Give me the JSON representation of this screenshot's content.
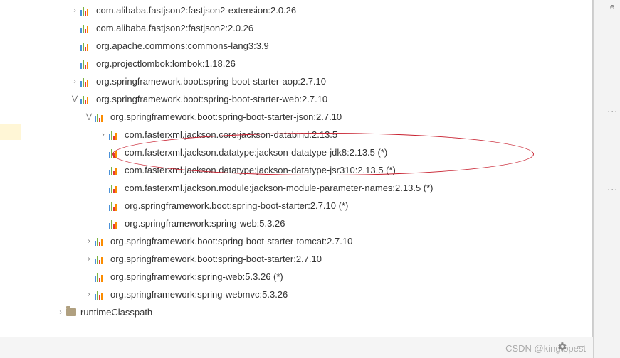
{
  "tree": {
    "items": [
      {
        "indent": "ind0",
        "exp": "collapsed",
        "icon": "lib",
        "label": "com.alibaba.fastjson2:fastjson2-extension:2.0.26"
      },
      {
        "indent": "ind0",
        "exp": "none",
        "icon": "lib",
        "label": "com.alibaba.fastjson2:fastjson2:2.0.26"
      },
      {
        "indent": "ind0",
        "exp": "none",
        "icon": "lib",
        "label": "org.apache.commons:commons-lang3:3.9"
      },
      {
        "indent": "ind0",
        "exp": "none",
        "icon": "lib",
        "label": "org.projectlombok:lombok:1.18.26"
      },
      {
        "indent": "ind0",
        "exp": "collapsed",
        "icon": "lib",
        "label": "org.springframework.boot:spring-boot-starter-aop:2.7.10"
      },
      {
        "indent": "ind0",
        "exp": "expanded",
        "icon": "lib",
        "label": "org.springframework.boot:spring-boot-starter-web:2.7.10"
      },
      {
        "indent": "ind1",
        "exp": "expanded",
        "icon": "lib",
        "label": "org.springframework.boot:spring-boot-starter-json:2.7.10"
      },
      {
        "indent": "ind2",
        "exp": "collapsed",
        "icon": "lib",
        "label": "com.fasterxml.jackson.core:jackson-databind:2.13.5"
      },
      {
        "indent": "ind2",
        "exp": "none",
        "icon": "lib",
        "label": "com.fasterxml.jackson.datatype:jackson-datatype-jdk8:2.13.5 (*)"
      },
      {
        "indent": "ind2",
        "exp": "none",
        "icon": "lib",
        "label": "com.fasterxml.jackson.datatype:jackson-datatype-jsr310:2.13.5 (*)"
      },
      {
        "indent": "ind2",
        "exp": "none",
        "icon": "lib",
        "label": "com.fasterxml.jackson.module:jackson-module-parameter-names:2.13.5 (*)"
      },
      {
        "indent": "ind2",
        "exp": "none",
        "icon": "lib",
        "label": "org.springframework.boot:spring-boot-starter:2.7.10 (*)"
      },
      {
        "indent": "ind2",
        "exp": "none",
        "icon": "lib",
        "label": "org.springframework:spring-web:5.3.26"
      },
      {
        "indent": "ind1",
        "exp": "collapsed",
        "icon": "lib",
        "label": "org.springframework.boot:spring-boot-starter-tomcat:2.7.10"
      },
      {
        "indent": "ind1",
        "exp": "collapsed",
        "icon": "lib",
        "label": "org.springframework.boot:spring-boot-starter:2.7.10"
      },
      {
        "indent": "ind1",
        "exp": "none",
        "icon": "lib",
        "label": "org.springframework:spring-web:5.3.26 (*)"
      },
      {
        "indent": "ind1",
        "exp": "collapsed",
        "icon": "lib",
        "label": "org.springframework:spring-webmvc:5.3.26"
      },
      {
        "indent": "indR",
        "exp": "collapsed",
        "icon": "folder",
        "label": "runtimeClasspath"
      }
    ]
  },
  "watermark": "CSDN @kingtopest",
  "side": {
    "tab": "e"
  }
}
